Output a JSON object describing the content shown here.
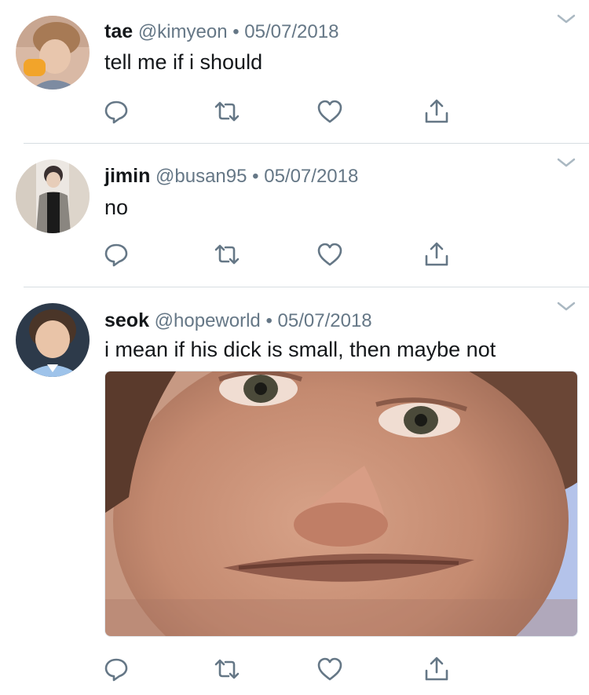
{
  "tweets": [
    {
      "name": "tae",
      "handle": "@kimyeon",
      "separator": "•",
      "date": "05/07/2018",
      "text": "tell me if i should",
      "avatar_icon": "avatar-tae"
    },
    {
      "name": "jimin",
      "handle": "@busan95",
      "separator": "•",
      "date": "05/07/2018",
      "text": "no",
      "avatar_icon": "avatar-jimin"
    },
    {
      "name": "seok",
      "handle": "@hopeworld",
      "separator": "•",
      "date": "05/07/2018",
      "text": "i mean if his dick is small, then maybe not",
      "avatar_icon": "avatar-seok",
      "media": "close-up-face-photo"
    }
  ],
  "actions": [
    "reply-icon",
    "retweet-icon",
    "like-icon",
    "share-icon"
  ],
  "colors": {
    "icon": "#657786",
    "divider": "#d7dde2",
    "text": "#14171a",
    "meta": "#657786"
  }
}
